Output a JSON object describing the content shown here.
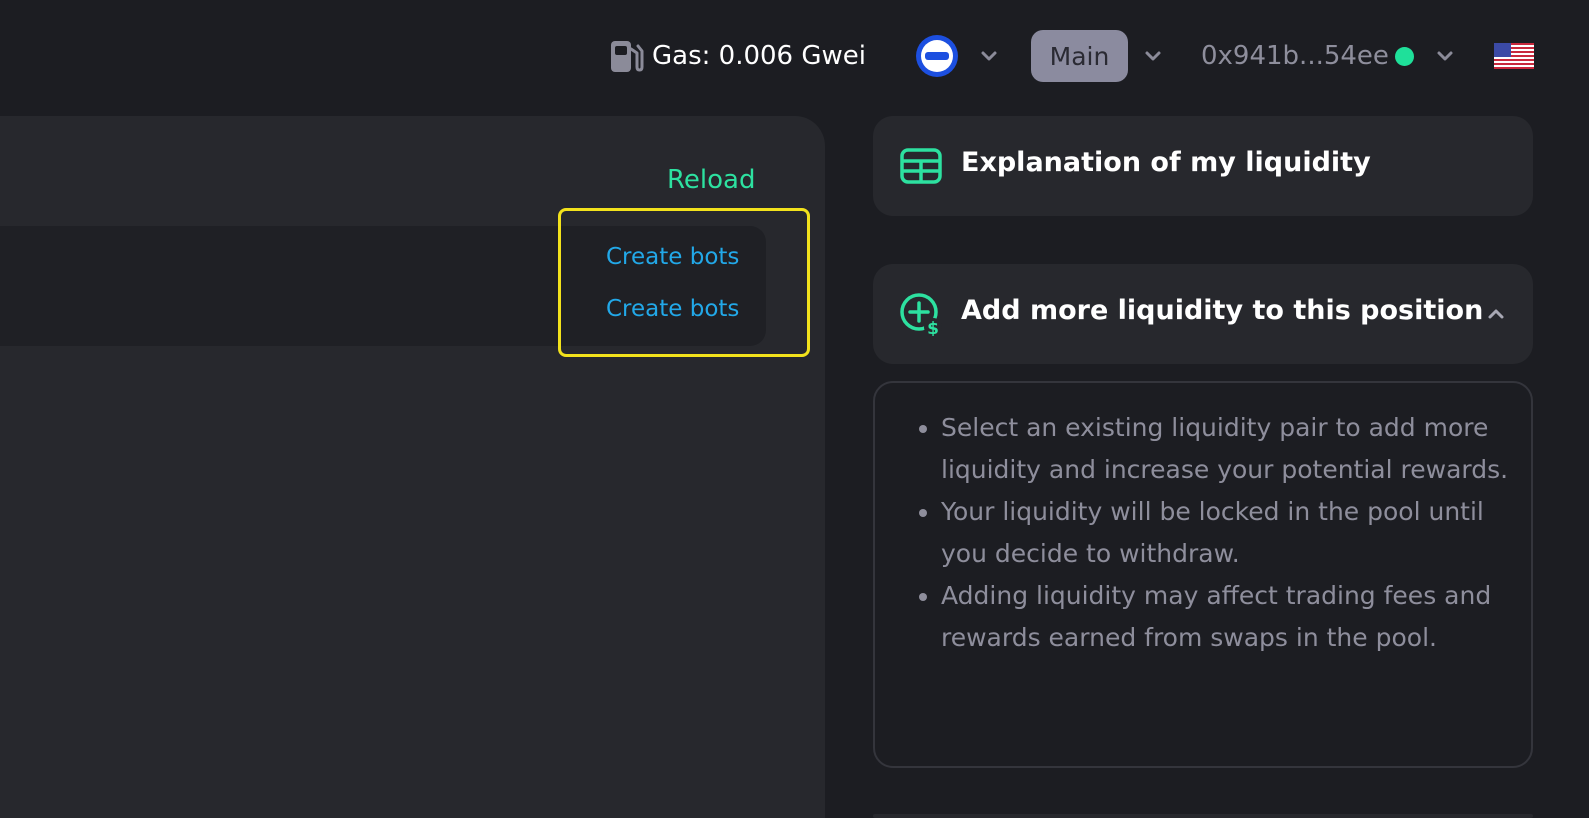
{
  "header": {
    "gas_label": "Gas: 0.006 Gwei",
    "network_label": "Main",
    "wallet_address": "0x941b...54ee",
    "icons": {
      "gas": "gas-pump-icon",
      "chain": "chain-logo-icon",
      "dropdown": "chevron-down-icon",
      "status": "connected-dot",
      "language": "us-flag-icon"
    },
    "colors": {
      "status_dot": "#1fe09a",
      "chain": "#1c4fe0"
    }
  },
  "left_panel": {
    "reload_label": "Reload",
    "bot_links": [
      "Create bots",
      "Create bots"
    ]
  },
  "right_panel": {
    "explanation_title": "Explanation of my liquidity",
    "add_liquidity_title": "Add more liquidity to this position",
    "add_liquidity_points": [
      "Select an existing liquidity pair to add more liquidity and increase your potential rewards.",
      "Your liquidity will be locked in the pool until you decide to withdraw.",
      "Adding liquidity may affect trading fees and rewards earned from swaps in the pool."
    ],
    "icons": {
      "explanation": "table-icon",
      "add": "add-dollar-icon",
      "collapse": "chevron-up-icon"
    }
  },
  "colors": {
    "accent_green": "#2de1a0",
    "link_blue": "#22a8e8",
    "highlight": "#f2e21c"
  }
}
